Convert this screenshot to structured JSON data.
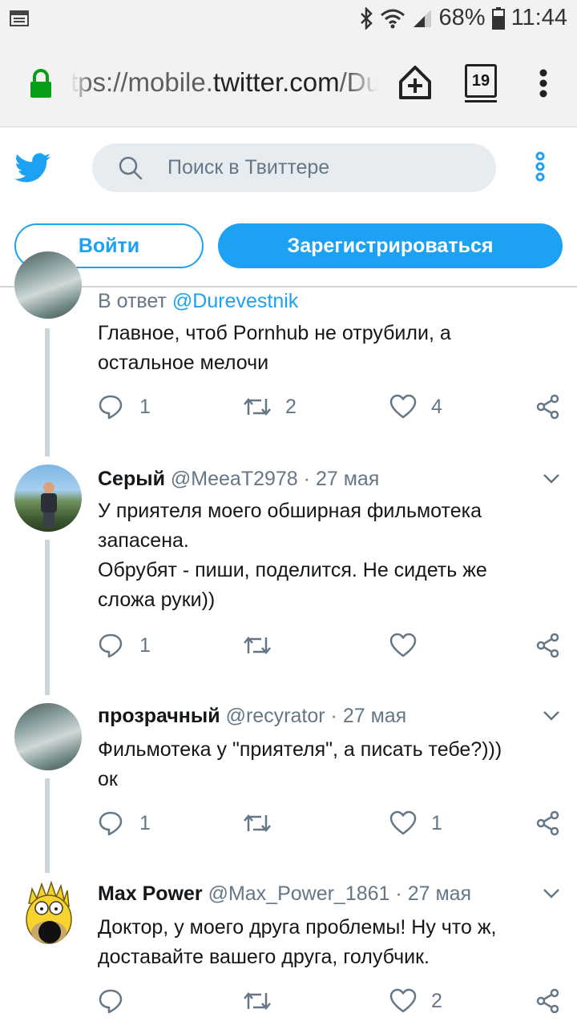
{
  "status_bar": {
    "battery": "68%",
    "time": "11:44"
  },
  "browser": {
    "url_prefix": "tps://mobile.",
    "url_host": "twitter.com",
    "url_suffix": "/Du",
    "tab_count": "19"
  },
  "twitter": {
    "search_placeholder": "Поиск в Твиттере",
    "login_label": "Войти",
    "signup_label": "Зарегистрироваться"
  },
  "tweets": [
    {
      "reply_prefix": "В ответ ",
      "reply_mention": "@Durevestnik",
      "lines": [
        "Главное, чтоб Pornhub не отрубили, а",
        "остальное мелочи"
      ],
      "reply_count": "1",
      "retweet_count": "2",
      "like_count": "4"
    },
    {
      "name": "Серый",
      "handle": "@MeeaT2978",
      "sep": " · ",
      "date": "27 мая",
      "lines": [
        "У приятеля моего обширная фильмотека",
        "запасена.",
        "Обрубят - пиши, поделится. Не сидеть же",
        "сложа руки))"
      ],
      "reply_count": "1",
      "retweet_count": "",
      "like_count": ""
    },
    {
      "name": "прозрачный",
      "handle": "@recyrator",
      "sep": " · ",
      "date": "27 мая",
      "lines": [
        "Фильмотека у \"приятеля\", а писать тебе?)))",
        "ок"
      ],
      "reply_count": "1",
      "retweet_count": "",
      "like_count": "1"
    },
    {
      "name": "Max Power",
      "handle": "@Max_Power_1861",
      "sep": " · ",
      "date": "27 мая",
      "lines": [
        "Доктор, у моего друга проблемы! Ну что ж,",
        "доставайте вашего друга, голубчик."
      ],
      "reply_count": "",
      "retweet_count": "",
      "like_count": "2"
    }
  ],
  "colors": {
    "twitter_blue": "#1da1f2",
    "muted": "#657786",
    "thread": "#ccd6dd"
  },
  "icons": [
    "bluetooth-icon",
    "wifi-icon",
    "signal-icon",
    "battery-icon",
    "lock-icon",
    "home-add-icon",
    "tabs-icon",
    "kebab-menu-icon",
    "twitter-bird-icon",
    "search-icon",
    "more-vertical-icon",
    "reply-icon",
    "retweet-icon",
    "like-icon",
    "share-icon",
    "chevron-down-icon"
  ]
}
